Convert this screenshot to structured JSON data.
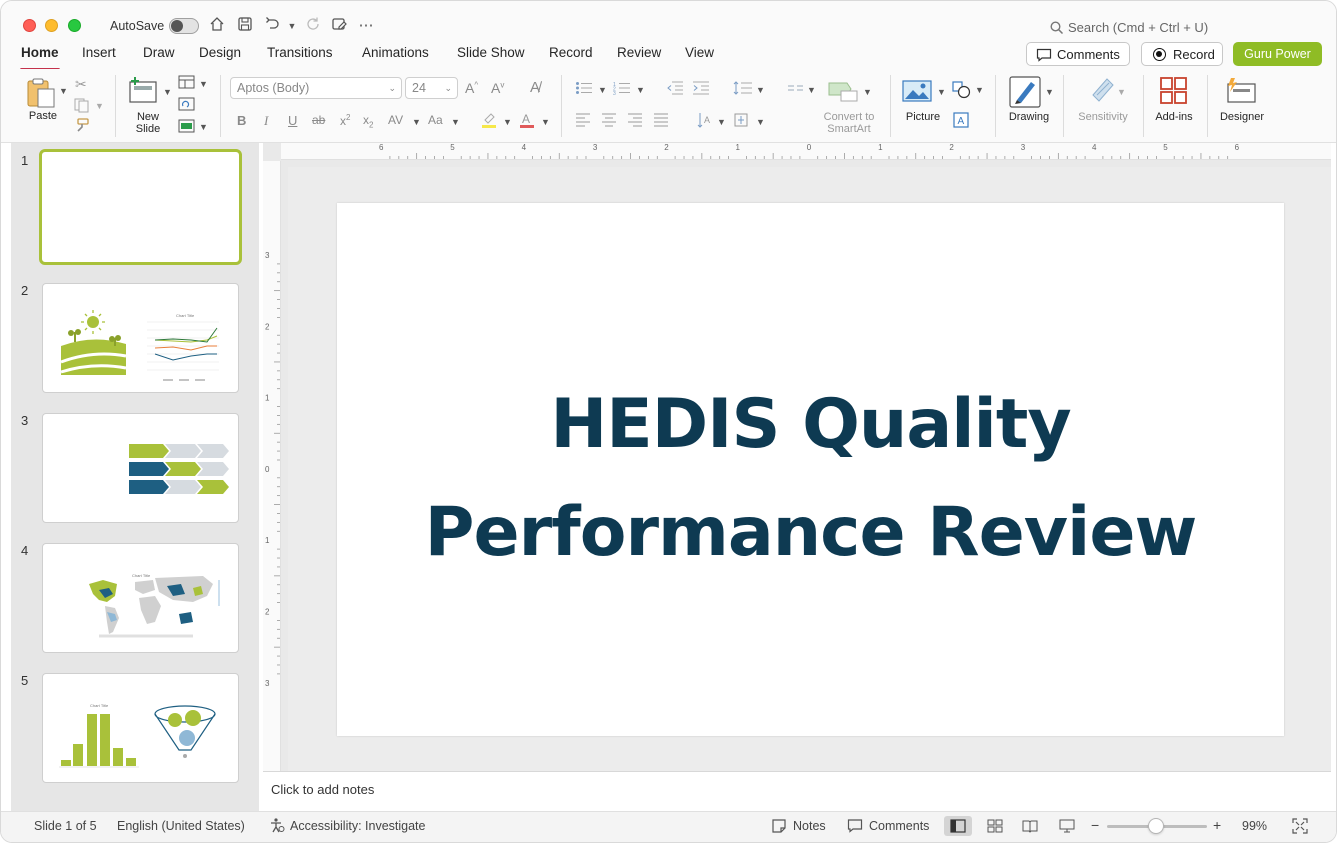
{
  "titlebar": {
    "autosave_label": "AutoSave",
    "search_placeholder": "Search (Cmd + Ctrl + U)"
  },
  "tabs": [
    {
      "label": "Home",
      "active": true
    },
    {
      "label": "Insert"
    },
    {
      "label": "Draw"
    },
    {
      "label": "Design"
    },
    {
      "label": "Transitions"
    },
    {
      "label": "Animations"
    },
    {
      "label": "Slide Show"
    },
    {
      "label": "Record"
    },
    {
      "label": "Review"
    },
    {
      "label": "View"
    }
  ],
  "header_buttons": {
    "comments": "Comments",
    "record": "Record",
    "guru": "Guru Power"
  },
  "ribbon": {
    "paste": "Paste",
    "new_slide_line1": "New",
    "new_slide_line2": "Slide",
    "font_name": "Aptos (Body)",
    "font_size": "24",
    "convert_line1": "Convert to",
    "convert_line2": "SmartArt",
    "picture": "Picture",
    "drawing": "Drawing",
    "sensitivity": "Sensitivity",
    "addins": "Add-ins",
    "designer": "Designer"
  },
  "thumbnails": [
    "1",
    "2",
    "3",
    "4",
    "5"
  ],
  "thumbnail_text": {
    "chart_title": "Chart Title"
  },
  "slide": {
    "title_line1": "HEDIS Quality",
    "title_line2": "Performance Review"
  },
  "notes": {
    "placeholder": "Click to add notes"
  },
  "statusbar": {
    "slide_info": "Slide 1 of 5",
    "language": "English (United States)",
    "accessibility": "Accessibility: Investigate",
    "notes": "Notes",
    "comments": "Comments",
    "zoom": "99%"
  },
  "ruler": {
    "h_labels": [
      "6",
      "5",
      "4",
      "3",
      "2",
      "1",
      "0",
      "1",
      "2",
      "3",
      "4",
      "5",
      "6"
    ],
    "v_labels": [
      "3",
      "2",
      "1",
      "0",
      "1",
      "2",
      "3"
    ]
  },
  "colors": {
    "accent_red": "#c4314b",
    "guru_green": "#8fbc25",
    "title_navy": "#0e3a52",
    "thumb_green": "#a9c13a",
    "thumb_blue": "#1e5f82"
  }
}
